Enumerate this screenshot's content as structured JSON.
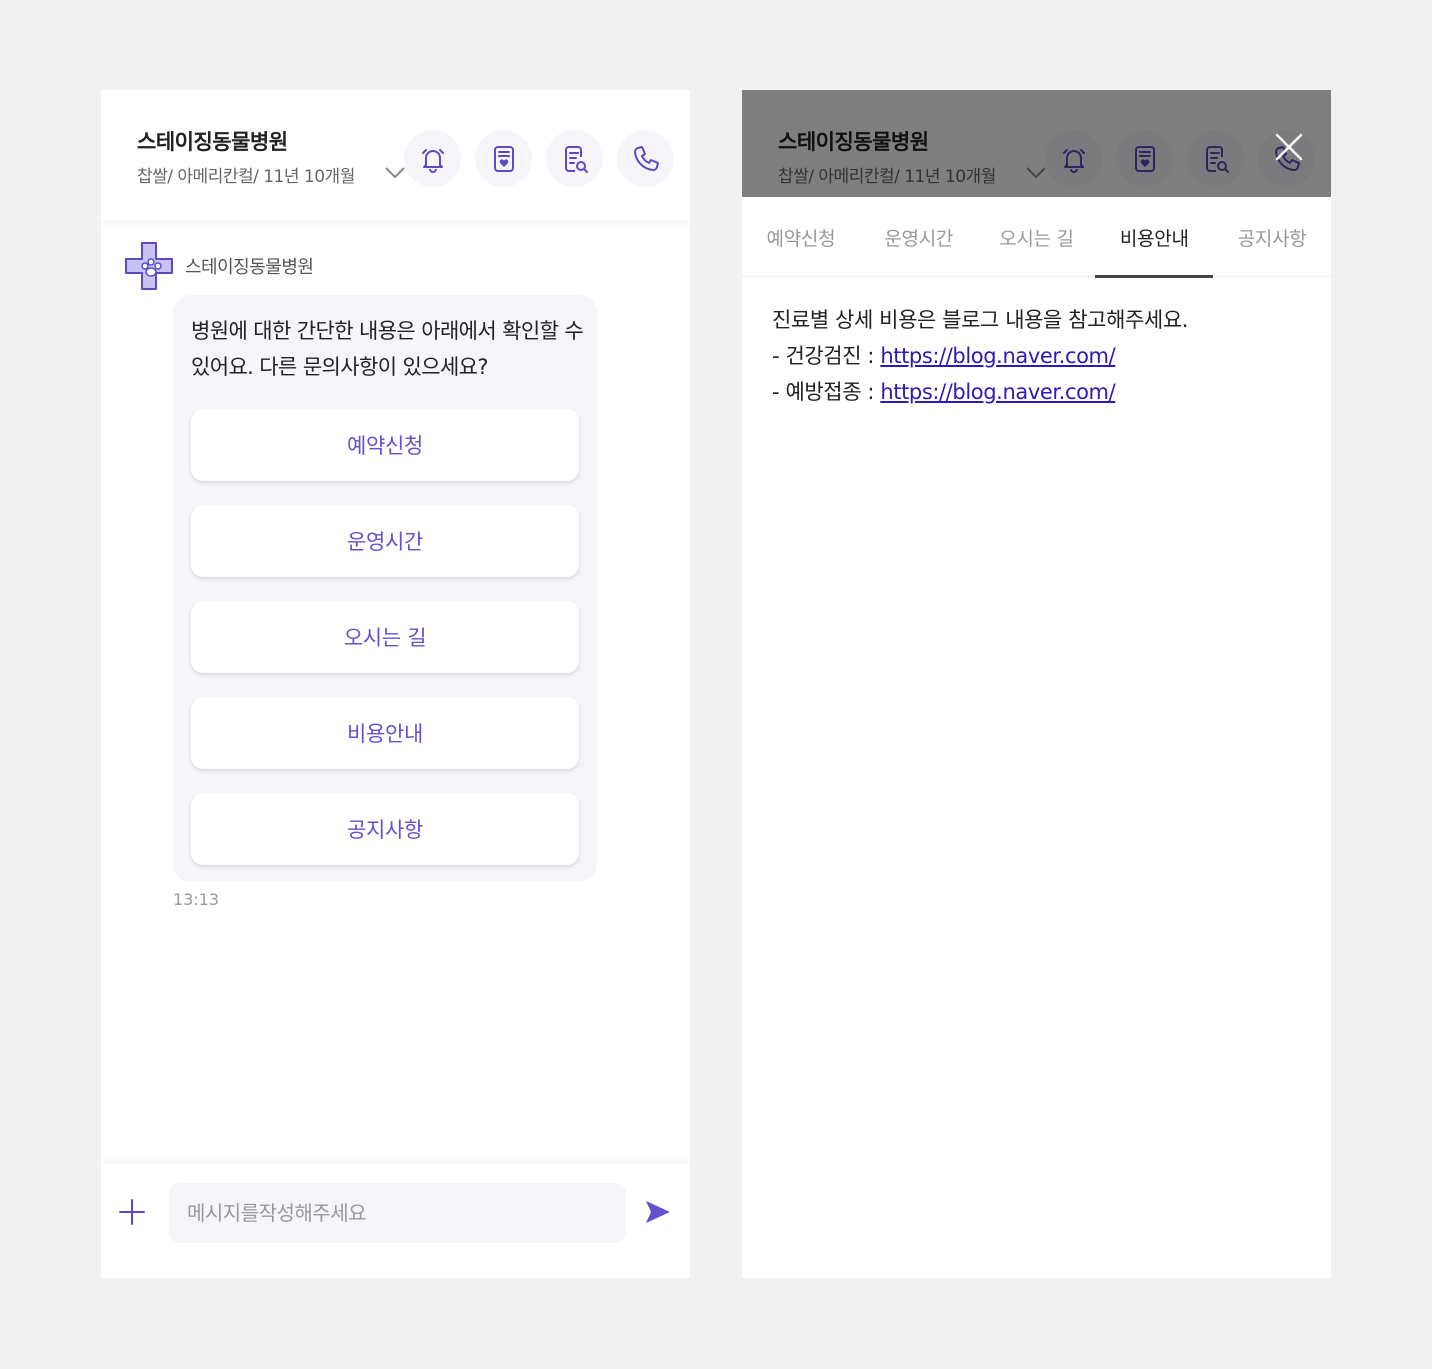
{
  "header": {
    "title": "스테이징동물병원",
    "subtitle": "찹쌀/ 아메리칸컬/ 11년 10개월",
    "icons": [
      "bell-icon",
      "heart-document-icon",
      "document-search-icon",
      "phone-icon"
    ]
  },
  "chat": {
    "bot_name": "스테이징동물병원",
    "message": "병원에 대한 간단한 내용은 아래에서 확인할 수 있어요. 다른 문의사항이 있으세요?",
    "quick_replies": [
      {
        "label": "예약신청"
      },
      {
        "label": "운영시간"
      },
      {
        "label": "오시는 길"
      },
      {
        "label": "비용안내"
      },
      {
        "label": "공지사항"
      }
    ],
    "timestamp": "13:13"
  },
  "composer": {
    "placeholder": "메시지를작성해주세요"
  },
  "detail": {
    "tabs": [
      {
        "label": "예약신청"
      },
      {
        "label": "운영시간"
      },
      {
        "label": "오시는 길"
      },
      {
        "label": "비용안내"
      },
      {
        "label": "공지사항"
      }
    ],
    "active_tab": "비용안내",
    "intro": "진료별 상세 비용은 블로그 내용을 참고해주세요.",
    "items": [
      {
        "prefix": "- 건강검진 : ",
        "link": "https://blog.naver.com/"
      },
      {
        "prefix": "- 예방접종 : ",
        "link": "https://blog.naver.com/"
      }
    ]
  },
  "colors": {
    "accent": "#6650d0",
    "link": "#2d1ab7",
    "bubble_bg": "#f6f6fa",
    "page_bg": "#f1f1f2"
  }
}
